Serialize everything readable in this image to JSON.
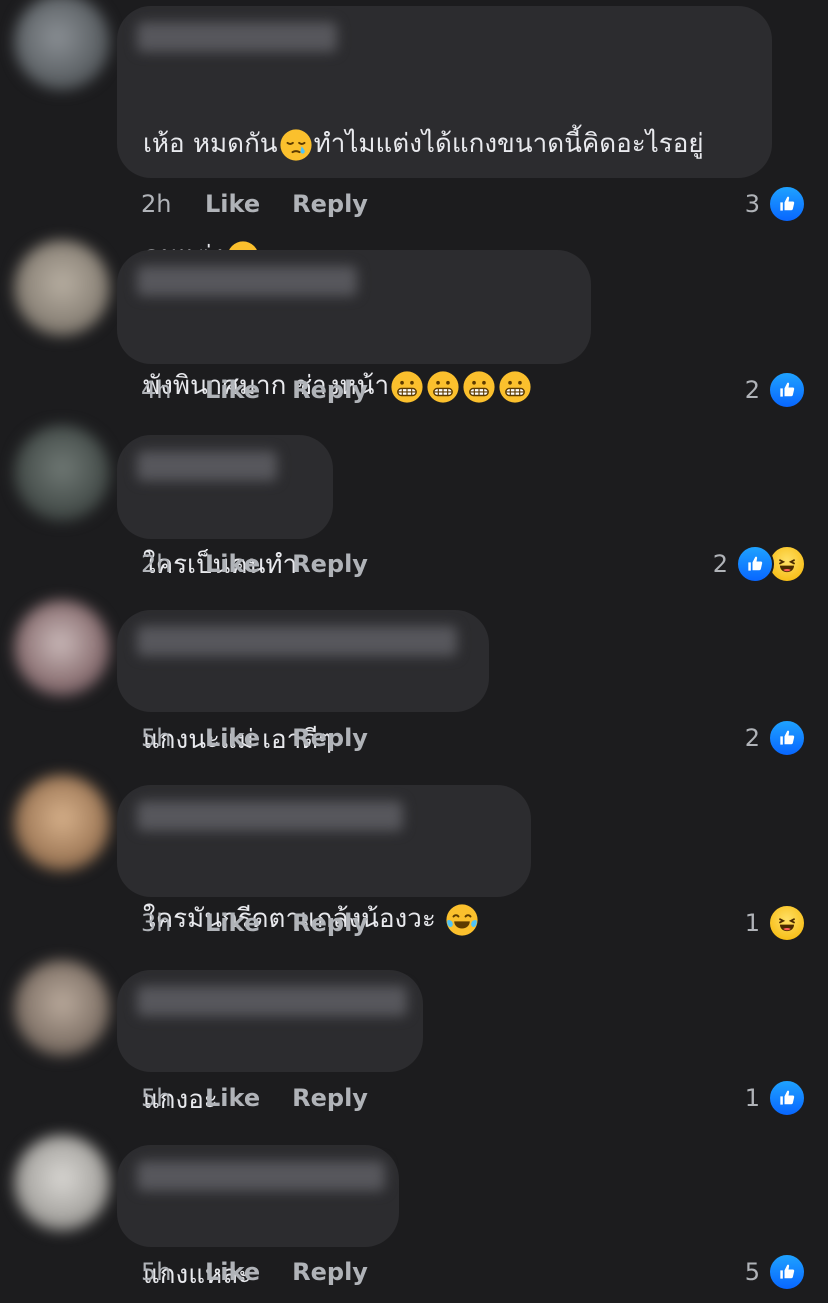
{
  "actions": {
    "like_label": "Like",
    "reply_label": "Reply"
  },
  "colors": {
    "like_blue": "#0866ff",
    "haha_yellow": "#f5b400",
    "bubble": "#2c2c2f",
    "background": "#1c1c1e"
  },
  "comments": [
    {
      "text_line1": "เห้อ หมดกัน",
      "text_line1b": "ทำไมแต่งได้แกงขนาดนี้คิดอะไรอยู่",
      "text_line2": "คนแต่ง",
      "emojis": [
        "sleepy-face-icon",
        "pleading-face-icon"
      ],
      "time": "2h",
      "reaction_count": "3",
      "reactions": [
        "like-icon"
      ]
    },
    {
      "text_line1": "พังพินาศมาก ช่างหน้า",
      "emojis": [
        "grimacing-face-icon",
        "grimacing-face-icon",
        "grimacing-face-icon",
        "grimacing-face-icon"
      ],
      "time": "4h",
      "reaction_count": "2",
      "reactions": [
        "like-icon"
      ]
    },
    {
      "text_line1": "ใครเป็นคนทำ",
      "time": "2h",
      "reaction_count": "2",
      "reactions": [
        "like-icon",
        "haha-icon"
      ]
    },
    {
      "text_line1": "แกงนะแม่ เอาดีๆ",
      "time": "5h",
      "reaction_count": "2",
      "reactions": [
        "like-icon"
      ]
    },
    {
      "text_line1": "ใครมันกรีดตาแกล้งน้องวะ",
      "emojis": [
        "tears-of-joy-icon"
      ],
      "time": "3h",
      "reaction_count": "1",
      "reactions": [
        "haha-icon"
      ]
    },
    {
      "text_line1": "แกงอะ",
      "time": "5h",
      "reaction_count": "1",
      "reactions": [
        "like-icon"
      ]
    },
    {
      "text_line1": "แกงแหละ",
      "time": "5h",
      "reaction_count": "5",
      "reactions": [
        "like-icon"
      ]
    }
  ]
}
